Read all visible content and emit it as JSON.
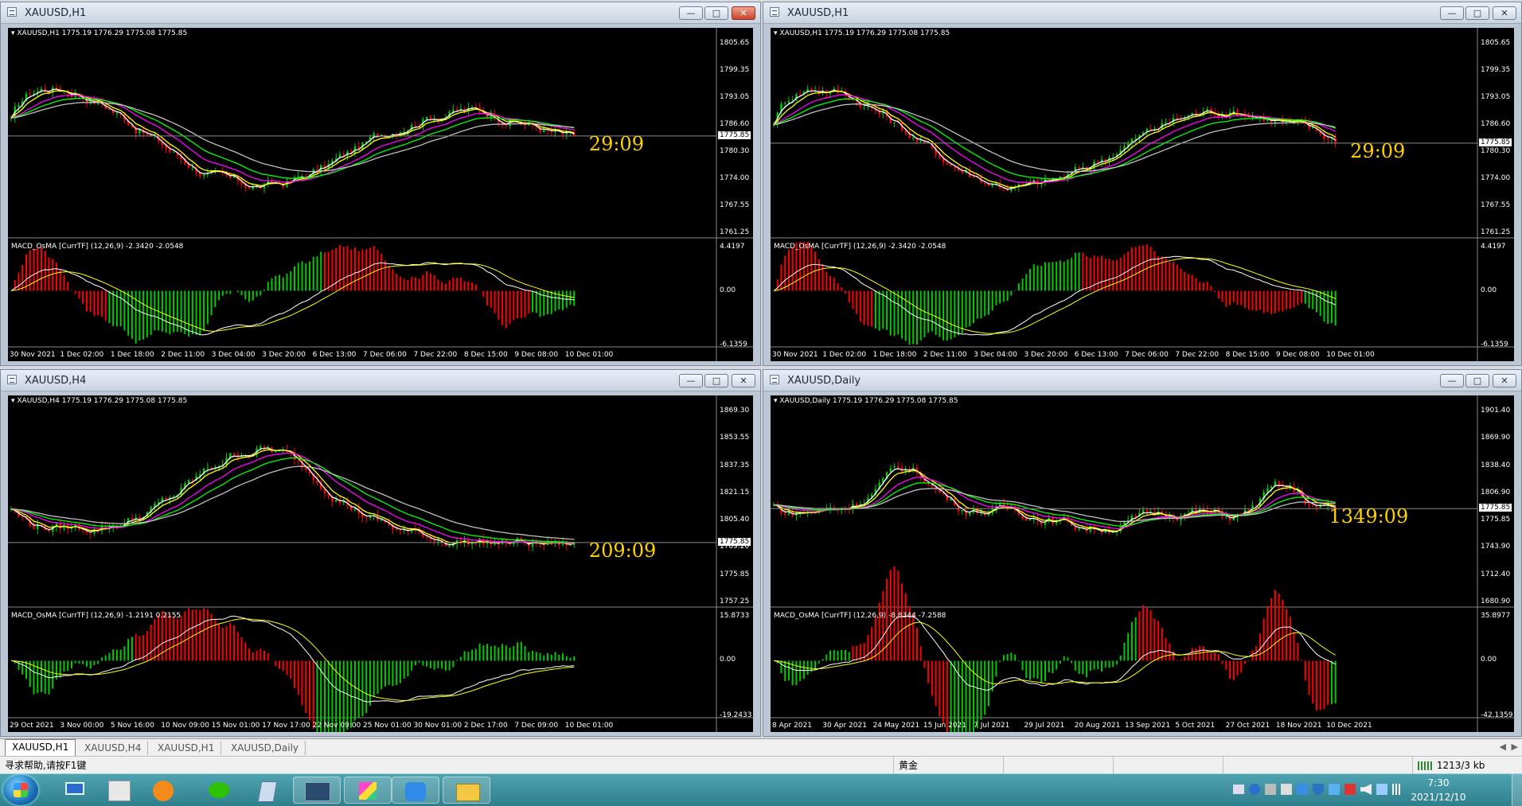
{
  "colors": {
    "bull": "#00cc00",
    "bear": "#ff0000",
    "ma_white": "#ffffff",
    "ma_yellow": "#ffff00",
    "ma_magenta": "#ff00ff",
    "ma_green": "#00ff00",
    "ma_silver": "#c0c0c0",
    "timer": "#ffd000",
    "macd_signal_yellow": "#ffff00"
  },
  "windows": [
    {
      "title": "XAUUSD,H1",
      "close_style": "red",
      "header": "XAUUSD,H1  1775.19 1776.29 1775.08 1775.85",
      "price_labels": [
        "1805.65",
        "1799.35",
        "1793.05",
        "1786.60",
        "1780.30",
        "1774.00",
        "1767.55",
        "1761.25"
      ],
      "current_price": "1775.85",
      "timer": "29:09",
      "indicator_header": "MACD_OsMA [CurrTF] (12,26,9) -2.3420 -2.0548",
      "indicator_labels": [
        "4.4197",
        "0.00",
        "-6.1359"
      ],
      "time_labels": [
        "30 Nov 2021",
        "1 Dec 02:00",
        "1 Dec 18:00",
        "2 Dec 11:00",
        "3 Dec 04:00",
        "3 Dec 20:00",
        "6 Dec 13:00",
        "7 Dec 06:00",
        "7 Dec 22:00",
        "8 Dec 15:00",
        "9 Dec 08:00",
        "10 Dec 01:00"
      ]
    },
    {
      "title": "XAUUSD,H1",
      "close_style": "plain",
      "header": "XAUUSD,H1  1775.19 1776.29 1775.08 1775.85",
      "price_labels": [
        "1805.65",
        "1799.35",
        "1793.05",
        "1786.60",
        "1780.30",
        "1774.00",
        "1767.55",
        "1761.25"
      ],
      "current_price": "1775.85",
      "timer": "29:09",
      "indicator_header": "MACD_OsMA [CurrTF] (12,26,9) -2.3420 -2.0548",
      "indicator_labels": [
        "4.4197",
        "0.00",
        "-6.1359"
      ],
      "time_labels": [
        "30 Nov 2021",
        "1 Dec 02:00",
        "1 Dec 18:00",
        "2 Dec 11:00",
        "3 Dec 04:00",
        "3 Dec 20:00",
        "6 Dec 13:00",
        "7 Dec 06:00",
        "7 Dec 22:00",
        "8 Dec 15:00",
        "9 Dec 08:00",
        "10 Dec 01:00"
      ]
    },
    {
      "title": "XAUUSD,H4",
      "close_style": "plain",
      "header": "XAUUSD,H4  1775.19 1776.29 1775.08 1775.85",
      "price_labels": [
        "1869.30",
        "1853.55",
        "1837.35",
        "1821.15",
        "1805.40",
        "1789.20",
        "1775.85",
        "1757.25"
      ],
      "current_price": "1775.85",
      "timer": "209:09",
      "indicator_header": "MACD_OsMA [CurrTF] (12,26,9) -1.2191 0.2155",
      "indicator_labels": [
        "15.8733",
        "0.00",
        "-19.2433"
      ],
      "time_labels": [
        "29 Oct 2021",
        "3 Nov 00:00",
        "5 Nov 16:00",
        "10 Nov 09:00",
        "15 Nov 01:00",
        "17 Nov 17:00",
        "22 Nov 09:00",
        "25 Nov 01:00",
        "30 Nov 01:00",
        "2 Dec 17:00",
        "7 Dec 09:00",
        "10 Dec 01:00"
      ]
    },
    {
      "title": "XAUUSD,Daily",
      "close_style": "plain",
      "header": "XAUUSD,Daily  1775.19 1776.29 1775.08 1775.85",
      "price_labels": [
        "1901.40",
        "1869.90",
        "1838.40",
        "1806.90",
        "1775.85",
        "1743.90",
        "1712.40",
        "1680.90"
      ],
      "current_price": "1775.85",
      "timer": "1349:09",
      "indicator_header": "MACD_OsMA [CurrTF] (12,26,9) -8.8344 -7.2588",
      "indicator_labels": [
        "35.8977",
        "0.00",
        "-42.1359"
      ],
      "time_labels": [
        "8 Apr 2021",
        "30 Apr 2021",
        "24 May 2021",
        "15 Jun 2021",
        "7 Jul 2021",
        "29 Jul 2021",
        "20 Aug 2021",
        "13 Sep 2021",
        "5 Oct 2021",
        "27 Oct 2021",
        "18 Nov 2021",
        "10 Dec 2021"
      ]
    }
  ],
  "tabs": [
    "XAUUSD,H1",
    "XAUUSD,H4",
    "XAUUSD,H1",
    "XAUUSD,Daily"
  ],
  "active_tab": 0,
  "status": {
    "help": "寻求帮助,请按F1键",
    "profile": "黄金",
    "connection": "1213/3 kb"
  },
  "taskbar": {
    "time": "7:30",
    "date": "2021/12/10"
  }
}
